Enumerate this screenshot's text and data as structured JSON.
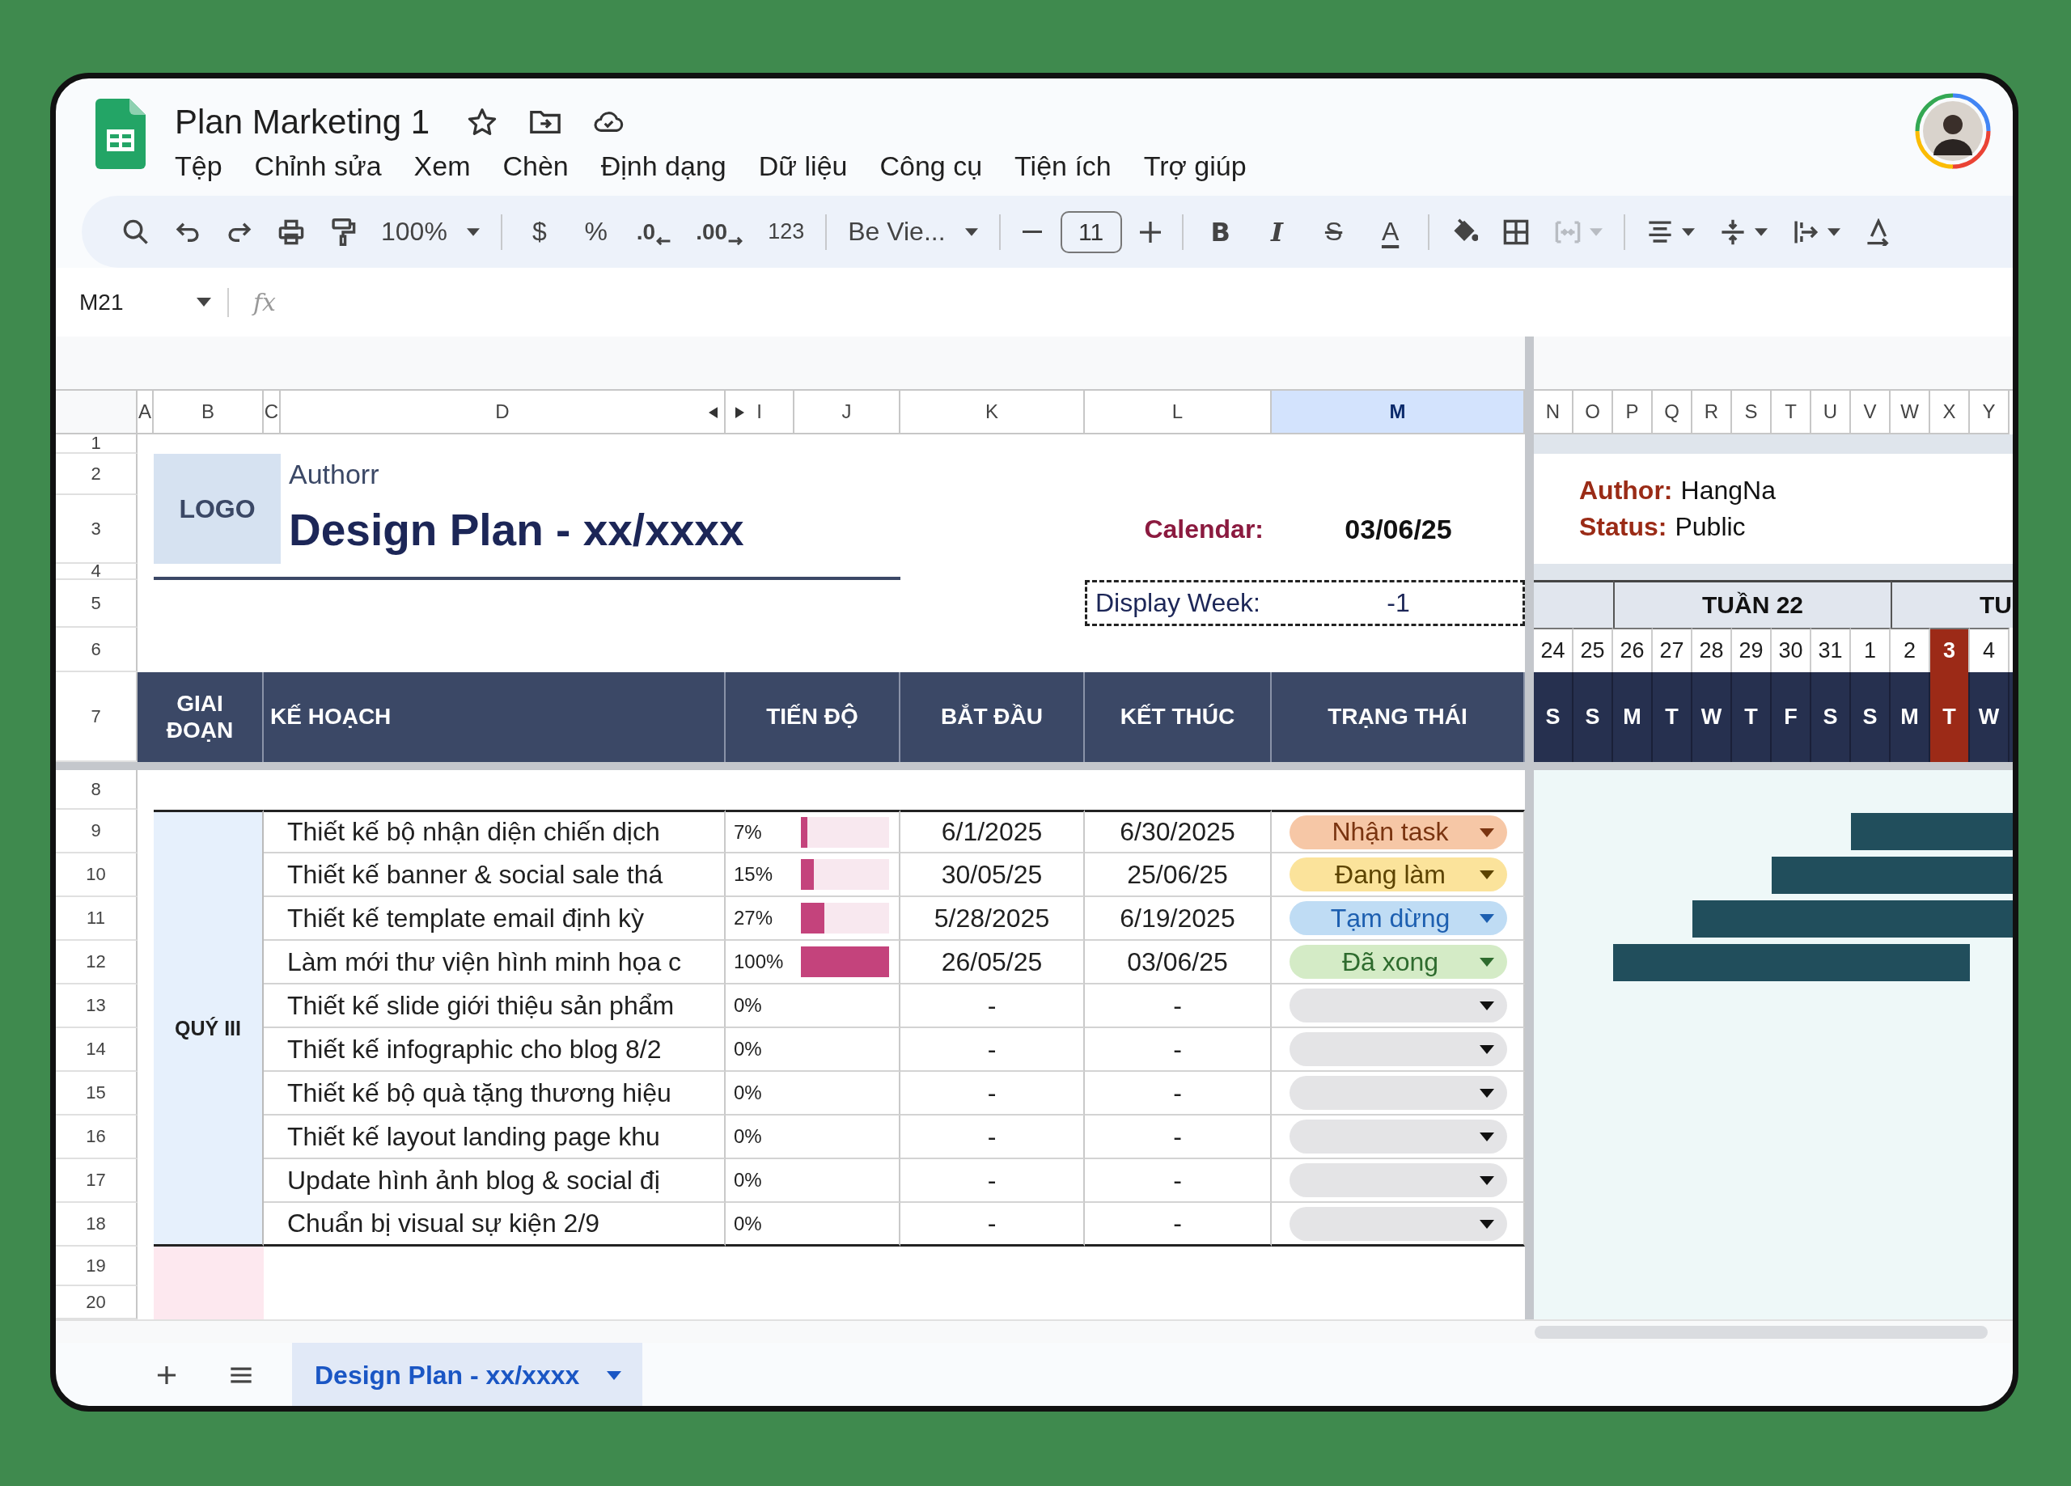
{
  "title": "Plan Marketing 1",
  "menu": [
    "Tệp",
    "Chỉnh sửa",
    "Xem",
    "Chèn",
    "Định dạng",
    "Dữ liệu",
    "Công cụ",
    "Tiện ích",
    "Trợ giúp"
  ],
  "toolbar": [
    {
      "kind": "search"
    },
    {
      "kind": "undo"
    },
    {
      "kind": "redo"
    },
    {
      "kind": "print"
    },
    {
      "kind": "paintformat"
    },
    {
      "kind": "dropdown",
      "label": "100%"
    },
    {
      "kind": "divider"
    },
    {
      "kind": "text",
      "label": "$"
    },
    {
      "kind": "text",
      "label": "%"
    },
    {
      "kind": "decrease",
      "label": ".0"
    },
    {
      "kind": "increase",
      "label": ".00"
    },
    {
      "kind": "format",
      "label": "123"
    },
    {
      "kind": "divider"
    },
    {
      "kind": "dropdown",
      "label": "Be Vie..."
    },
    {
      "kind": "divider"
    },
    {
      "kind": "minus"
    },
    {
      "kind": "fontsize",
      "label": "11"
    },
    {
      "kind": "plus"
    },
    {
      "kind": "divider"
    },
    {
      "kind": "bold",
      "label": "B"
    },
    {
      "kind": "italic",
      "label": "I"
    },
    {
      "kind": "strike",
      "label": "S"
    },
    {
      "kind": "textcolor",
      "label": "A"
    },
    {
      "kind": "divider"
    },
    {
      "kind": "fill"
    },
    {
      "kind": "borders"
    },
    {
      "kind": "merge"
    },
    {
      "kind": "divider"
    },
    {
      "kind": "align"
    },
    {
      "kind": "valign"
    },
    {
      "kind": "wrap"
    },
    {
      "kind": "rotate"
    }
  ],
  "name_box": "M21",
  "formula_label": "fx",
  "columns": [
    {
      "label": "A",
      "selected": false
    },
    {
      "label": "B",
      "selected": false
    },
    {
      "label": "C",
      "selected": false
    },
    {
      "label": "D",
      "selected": false
    },
    {
      "label": "I",
      "selected": false
    },
    {
      "label": "J",
      "selected": false
    },
    {
      "label": "K",
      "selected": false
    },
    {
      "label": "L",
      "selected": false
    },
    {
      "label": "M",
      "selected": true
    },
    {
      "label": "N",
      "selected": false
    },
    {
      "label": "O",
      "selected": false
    },
    {
      "label": "P",
      "selected": false
    },
    {
      "label": "Q",
      "selected": false
    },
    {
      "label": "R",
      "selected": false
    },
    {
      "label": "S",
      "selected": false
    },
    {
      "label": "T",
      "selected": false
    },
    {
      "label": "U",
      "selected": false
    },
    {
      "label": "V",
      "selected": false
    },
    {
      "label": "W",
      "selected": false
    },
    {
      "label": "X",
      "selected": false
    },
    {
      "label": "Y",
      "selected": false
    }
  ],
  "rows": [
    "1",
    "2",
    "3",
    "4",
    "5",
    "6",
    "7",
    "8",
    "9",
    "10",
    "11",
    "12",
    "13",
    "14",
    "15",
    "16",
    "17",
    "18",
    "19",
    "20"
  ],
  "header": {
    "logo": "LOGO",
    "author": "Authorr",
    "title": "Design Plan - xx/xxxx",
    "calendar_label": "Calendar:",
    "calendar_value": "03/06/25",
    "week_label": "Display Week:",
    "week_value": "-1"
  },
  "info": [
    {
      "label": "Author:",
      "value": "HangNa"
    },
    {
      "label": "Status:",
      "value": "Public"
    }
  ],
  "table_headers": [
    "GIAI ĐOẠN",
    "KẾ HOẠCH",
    "TIẾN ĐỘ",
    "BẮT ĐẦU",
    "KẾT THÚC",
    "TRẠNG THÁI"
  ],
  "group": "QUÝ III",
  "tasks": [
    {
      "name": "Thiết kế bộ nhận diện chiến dịch",
      "percent": "7%",
      "level": 0.07,
      "start": "6/1/2025",
      "end": "6/30/2025",
      "status": {
        "kind": "todo",
        "label": "Nhận task"
      },
      "gantt": [
        false,
        false,
        false,
        false,
        false,
        false,
        false,
        false,
        true,
        true,
        true,
        true
      ]
    },
    {
      "name": "Thiết kế banner & social sale thá",
      "percent": "15%",
      "level": 0.15,
      "start": "30/05/25",
      "end": "25/06/25",
      "status": {
        "kind": "doing",
        "label": "Đang làm"
      },
      "gantt": [
        false,
        false,
        false,
        false,
        false,
        false,
        true,
        true,
        true,
        true,
        true,
        true
      ]
    },
    {
      "name": "Thiết kế template email định kỳ",
      "percent": "27%",
      "level": 0.27,
      "start": "5/28/2025",
      "end": "6/19/2025",
      "status": {
        "kind": "paused",
        "label": "Tạm dừng"
      },
      "gantt": [
        false,
        false,
        false,
        false,
        true,
        true,
        true,
        true,
        true,
        true,
        true,
        true
      ]
    },
    {
      "name": "Làm mới thư viện hình minh họa c",
      "percent": "100%",
      "level": 1,
      "start": "26/05/25",
      "end": "03/06/25",
      "status": {
        "kind": "done",
        "label": "Đã xong"
      },
      "gantt": [
        false,
        false,
        true,
        true,
        true,
        true,
        true,
        true,
        true,
        true,
        true,
        false
      ]
    },
    {
      "name": "Thiết kế slide giới thiệu sản phẩm",
      "percent": "0%",
      "start": "-",
      "end": "-",
      "status": {
        "kind": "empty"
      },
      "gantt": [
        false,
        false,
        false,
        false,
        false,
        false,
        false,
        false,
        false,
        false,
        false,
        false
      ]
    },
    {
      "name": "Thiết kế infographic cho blog 8/2",
      "percent": "0%",
      "start": "-",
      "end": "-",
      "status": {
        "kind": "empty"
      },
      "gantt": [
        false,
        false,
        false,
        false,
        false,
        false,
        false,
        false,
        false,
        false,
        false,
        false
      ]
    },
    {
      "name": "Thiết kế bộ quà tặng thương hiệu",
      "percent": "0%",
      "start": "-",
      "end": "-",
      "status": {
        "kind": "empty"
      },
      "gantt": [
        false,
        false,
        false,
        false,
        false,
        false,
        false,
        false,
        false,
        false,
        false,
        false
      ]
    },
    {
      "name": "Thiết kế layout landing page khu",
      "percent": "0%",
      "start": "-",
      "end": "-",
      "status": {
        "kind": "empty"
      },
      "gantt": [
        false,
        false,
        false,
        false,
        false,
        false,
        false,
        false,
        false,
        false,
        false,
        false
      ]
    },
    {
      "name": "Update hình ảnh blog & social đị",
      "percent": "0%",
      "start": "-",
      "end": "-",
      "status": {
        "kind": "empty"
      },
      "gantt": [
        false,
        false,
        false,
        false,
        false,
        false,
        false,
        false,
        false,
        false,
        false,
        false
      ]
    },
    {
      "name": "Chuẩn bị visual sự kiện 2/9",
      "percent": "0%",
      "start": "-",
      "end": "-",
      "status": {
        "kind": "empty"
      },
      "gantt": [
        false,
        false,
        false,
        false,
        false,
        false,
        false,
        false,
        false,
        false,
        false,
        false
      ]
    }
  ],
  "gantt": {
    "weeks": [
      "TUẦN 22",
      "TU"
    ],
    "days": [
      {
        "date": "24",
        "weekday": "S",
        "selected": false
      },
      {
        "date": "25",
        "weekday": "S",
        "selected": false
      },
      {
        "date": "26",
        "weekday": "M",
        "selected": false
      },
      {
        "date": "27",
        "weekday": "T",
        "selected": false
      },
      {
        "date": "28",
        "weekday": "W",
        "selected": false
      },
      {
        "date": "29",
        "weekday": "T",
        "selected": false
      },
      {
        "date": "30",
        "weekday": "F",
        "selected": false
      },
      {
        "date": "31",
        "weekday": "S",
        "selected": false
      },
      {
        "date": "1",
        "weekday": "S",
        "selected": false
      },
      {
        "date": "2",
        "weekday": "M",
        "selected": false
      },
      {
        "date": "3",
        "weekday": "T",
        "selected": true
      },
      {
        "date": "4",
        "weekday": "W",
        "selected": false
      }
    ]
  },
  "sheet_tabs": [
    {
      "label": "Design Plan - xx/xxxx",
      "selected": true
    }
  ]
}
